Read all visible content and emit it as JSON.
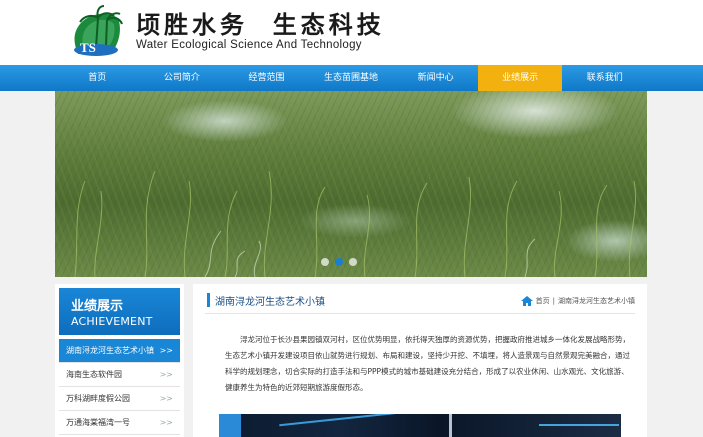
{
  "header": {
    "brand_cn": "顷胜水务  生态科技",
    "brand_en": "Water Ecological Science And Technology",
    "logo_letters": "TS"
  },
  "nav": {
    "items": [
      {
        "label": "首页"
      },
      {
        "label": "公司简介"
      },
      {
        "label": "经营范围"
      },
      {
        "label": "生态苗圃基地"
      },
      {
        "label": "新闻中心"
      },
      {
        "label": "业绩展示"
      },
      {
        "label": "联系我们"
      }
    ],
    "active_index": 5
  },
  "banner": {
    "slides": 3,
    "active_slide": 1
  },
  "sidebar": {
    "title": "业绩展示",
    "subtitle": "ACHIEVEMENT",
    "arrow": ">>",
    "items": [
      {
        "label": "湖南浔龙河生态艺术小镇"
      },
      {
        "label": "海南生态软件园"
      },
      {
        "label": "万科湖畔度假公园"
      },
      {
        "label": "万通海棠福湾一号"
      }
    ]
  },
  "main": {
    "title": "湖南浔龙河生态艺术小镇",
    "breadcrumb": {
      "home": "首页",
      "sep": "|",
      "current": "湖南浔龙河生态艺术小镇"
    },
    "paragraph": "浔龙河位于长沙县果园镇双河村，区位优势明显，依托得天独厚的资源优势，把握政府推进城乡一体化发展战略形势，生态艺术小镇开发建设项目依山就势进行规划、布局和建设，坚持少开挖、不填埋，将人造景观与自然景观完美融合，通过科学的规划理念，切合实际的打造手法和与PPP模式的城市基础建设充分结合，形成了以农业休闲、山水观光、文化旅游、健康养生为特色的近郊短期旅游度假形态。"
  },
  "colors": {
    "nav_blue": "#1a86d6",
    "nav_active": "#f2b10f",
    "title_blue": "#1a4f86"
  }
}
